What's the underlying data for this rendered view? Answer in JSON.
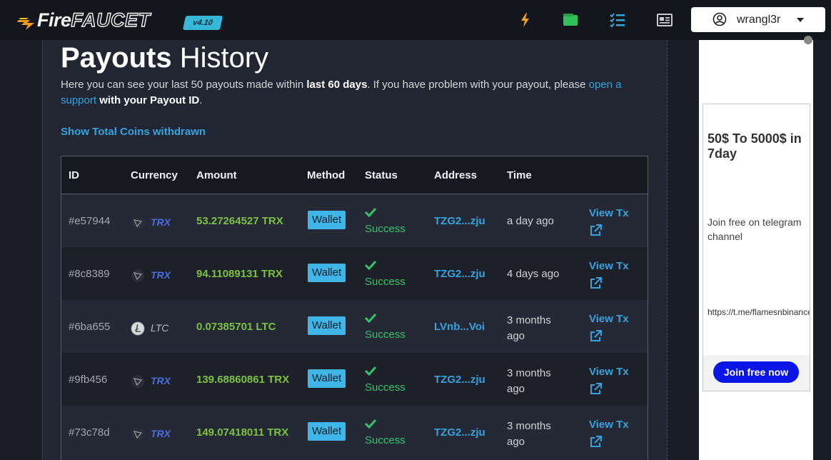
{
  "navbar": {
    "logo_fire": "Fire",
    "logo_faucet": "FAUCET",
    "version": "v4.10",
    "icons": [
      "bolt-icon",
      "wallet-icon",
      "tasks-icon",
      "news-icon"
    ],
    "username": "wrangl3r"
  },
  "page": {
    "title_bold": "Payouts",
    "title_rest": " History",
    "desc_1": "Here you can see your last 50 payouts made within ",
    "desc_bold1": "last 60 days",
    "desc_2": ". If you have problem with your payout, please ",
    "desc_link1": "open a",
    "desc_link2": "support",
    "desc_bold2": " with your Payout ID",
    "desc_3": ".",
    "total_link": "Show Total Coins withdrawn"
  },
  "table": {
    "headers": [
      "ID",
      "Currency",
      "Amount",
      "Method",
      "Status",
      "Address",
      "Time"
    ],
    "rows": [
      {
        "id": "#e57944",
        "currency": "TRX",
        "amount": "53.27264527 TRX",
        "method": "Wallet",
        "status": "Success",
        "address": "TZG2...zju",
        "time1": "a day ago",
        "time2": "",
        "view": "View Tx"
      },
      {
        "id": "#8c8389",
        "currency": "TRX",
        "amount": "94.11089131 TRX",
        "method": "Wallet",
        "status": "Success",
        "address": "TZG2...zju",
        "time1": "4 days ago",
        "time2": "",
        "view": "View Tx"
      },
      {
        "id": "#6ba655",
        "currency": "LTC",
        "amount": "0.07385701 LTC",
        "method": "Wallet",
        "status": "Success",
        "address": "LVnb...Voi",
        "time1": "3 months",
        "time2": "ago",
        "view": "View Tx"
      },
      {
        "id": "#9fb456",
        "currency": "TRX",
        "amount": "139.68860861 TRX",
        "method": "Wallet",
        "status": "Success",
        "address": "TZG2...zju",
        "time1": "3 months",
        "time2": "ago",
        "view": "View Tx"
      },
      {
        "id": "#73c78d",
        "currency": "TRX",
        "amount": "149.07418011 TRX",
        "method": "Wallet",
        "status": "Success",
        "address": "TZG2...zju",
        "time1": "3 months",
        "time2": "ago",
        "view": "View Tx"
      }
    ]
  },
  "ad": {
    "headline": "50$ To 5000$ in 7day",
    "text": "Join free on telegram channel",
    "url": "https://t.me/flamesnbinance",
    "button": "Join free now"
  },
  "colors": {
    "accent_link": "#36a3e0",
    "amount_green": "#7dc142",
    "success_green": "#35c46a",
    "wallet_badge": "#3fb5e8",
    "trx_blue": "#4a6ee0"
  }
}
